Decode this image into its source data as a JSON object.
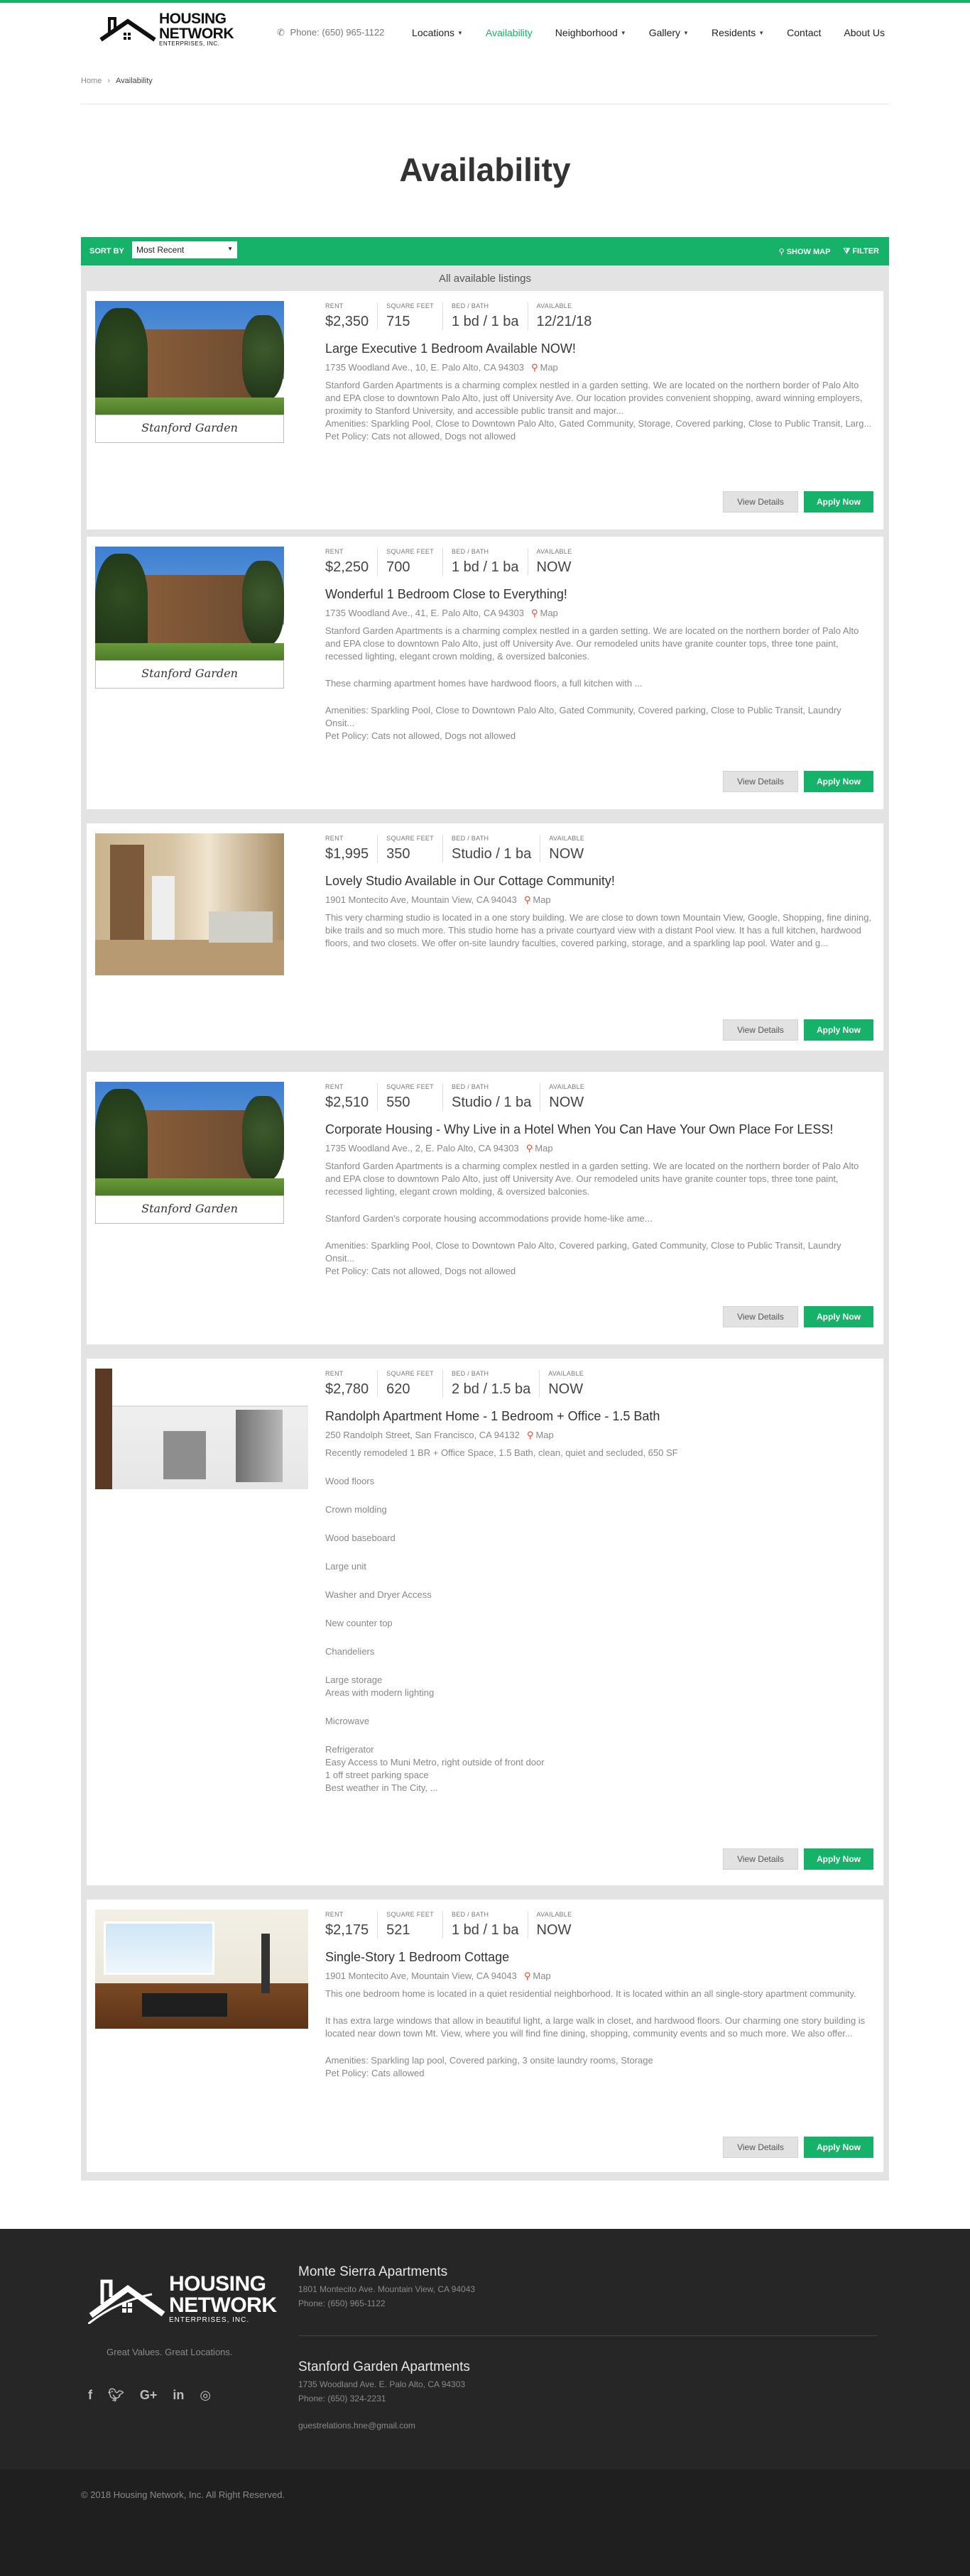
{
  "header": {
    "logo": {
      "line1": "HOUSING",
      "line2": "NETWORK",
      "line3": "ENTERPRISES, INC."
    },
    "phone": "Phone: (650) 965-1122",
    "nav": [
      {
        "label": "Locations",
        "dropdown": true,
        "active": false
      },
      {
        "label": "Availability",
        "dropdown": false,
        "active": true
      },
      {
        "label": "Neighborhood",
        "dropdown": true,
        "active": false
      },
      {
        "label": "Gallery",
        "dropdown": true,
        "active": false
      },
      {
        "label": "Residents",
        "dropdown": true,
        "active": false
      },
      {
        "label": "Contact",
        "dropdown": false,
        "active": false
      },
      {
        "label": "About Us",
        "dropdown": false,
        "active": false
      }
    ]
  },
  "breadcrumb": {
    "home": "Home",
    "separator": "›",
    "current": "Availability"
  },
  "page_title": "Availability",
  "toolbar": {
    "sort_label": "SORT BY",
    "sort_value": "Most Recent",
    "show_map": "SHOW MAP",
    "filter": "FILTER"
  },
  "listings_header": "All available listings",
  "labels": {
    "rent": "RENT",
    "sqft": "SQUARE FEET",
    "bed_bath": "BED / BATH",
    "available": "AVAILABLE",
    "map": "Map",
    "view_details": "View Details",
    "apply_now": "Apply Now"
  },
  "listings": [
    {
      "rent": "$2,350",
      "sqft": "715",
      "bed_bath": "1 bd / 1 ba",
      "available": "12/21/18",
      "title": "Large Executive 1 Bedroom Available NOW!",
      "address": "1735 Woodland Ave., 10, E. Palo Alto, CA 94303",
      "photo_caption": "Stanford Garden",
      "desc": [
        "Stanford Garden Apartments is a charming complex nestled in a garden setting. We are located on the northern border of Palo Alto and EPA close to downtown Palo Alto, just off University Ave. Our location provides convenient shopping, award winning employers, proximity to Stanford University, and accessible public transit and major...",
        "Amenities: Sparkling Pool, Close to Downtown Palo Alto, Gated Community, Storage, Covered parking, Close to Public Transit, Larg...",
        "Pet Policy: Cats not allowed, Dogs not allowed"
      ]
    },
    {
      "rent": "$2,250",
      "sqft": "700",
      "bed_bath": "1 bd / 1 ba",
      "available": "NOW",
      "title": "Wonderful 1 Bedroom Close to Everything!",
      "address": "1735 Woodland Ave., 41, E. Palo Alto, CA 94303",
      "photo_caption": "Stanford Garden",
      "desc": [
        "Stanford Garden Apartments is a charming complex nestled in a garden setting. We are located on the northern border of Palo Alto and EPA close to downtown Palo Alto, just off University Ave. Our remodeled units have granite counter tops, three tone paint, recessed lighting, elegant crown molding, & oversized balconies.",
        "These charming apartment homes have hardwood floors, a full kitchen with ...",
        "Amenities: Sparkling Pool, Close to Downtown Palo Alto, Gated Community, Covered parking, Close to Public Transit, Laundry Onsit...",
        "Pet Policy: Cats not allowed, Dogs not allowed"
      ]
    },
    {
      "rent": "$1,995",
      "sqft": "350",
      "bed_bath": "Studio / 1 ba",
      "available": "NOW",
      "title": "Lovely Studio Available in Our Cottage Community!",
      "address": "1901 Montecito Ave, Mountain View, CA 94043",
      "desc": [
        "This very charming studio is located in a one story building. We are close to down town Mountain View, Google, Shopping, fine dining, bike trails and so much more. This studio home has a private courtyard view with a distant Pool view. It has a full kitchen, hardwood floors, and two closets. We offer on-site laundry faculties, covered parking, storage, and a sparkling lap pool. Water and g..."
      ]
    },
    {
      "rent": "$2,510",
      "sqft": "550",
      "bed_bath": "Studio / 1 ba",
      "available": "NOW",
      "title": "Corporate Housing - Why Live in a Hotel When You Can Have Your Own Place For LESS!",
      "address": "1735 Woodland Ave., 2, E. Palo Alto, CA 94303",
      "photo_caption": "Stanford Garden",
      "desc": [
        "Stanford Garden Apartments is a charming complex nestled in a garden setting. We are located on the northern border of Palo Alto and EPA close to downtown Palo Alto, just off University Ave. Our remodeled units have granite counter tops, three tone paint, recessed lighting, elegant crown molding, & oversized balconies.",
        "Stanford Garden's corporate housing accommodations provide home-like ame...",
        "Amenities: Sparkling Pool, Close to Downtown Palo Alto, Covered parking, Gated Community, Close to Public Transit, Laundry Onsit...",
        "Pet Policy: Cats not allowed, Dogs not allowed"
      ]
    },
    {
      "rent": "$2,780",
      "sqft": "620",
      "bed_bath": "2 bd / 1.5 ba",
      "available": "NOW",
      "title": "Randolph Apartment Home - 1 Bedroom + Office - 1.5 Bath",
      "address": "250 Randolph Street, San Francisco, CA 94132",
      "desc_intro": "Recently remodeled 1 BR + Office Space, 1.5 Bath, clean, quiet and secluded, 650 SF",
      "features": [
        "Wood floors",
        "Crown molding",
        "Wood baseboard",
        "Large unit",
        "Washer and Dryer Access",
        "New counter top",
        "Chandeliers"
      ],
      "features_b": [
        "Large storage",
        "Areas with modern lighting"
      ],
      "features_c": [
        "Microwave"
      ],
      "features_d": [
        "Refrigerator",
        "Easy Access to Muni Metro, right outside of front door",
        "1 off street parking space",
        "Best weather in The City, ..."
      ]
    },
    {
      "rent": "$2,175",
      "sqft": "521",
      "bed_bath": "1 bd / 1 ba",
      "available": "NOW",
      "title": "Single-Story 1 Bedroom Cottage",
      "address": "1901 Montecito Ave, Mountain View, CA 94043",
      "desc": [
        "This one bedroom home is located in a quiet residential neighborhood. It is located within an all single-story apartment community.",
        "It has extra large windows that allow in beautiful light, a large walk in closet, and hardwood floors. Our charming one story building is located near down town Mt. View, where you will find fine dining, shopping, community events and so much more. We also offer...",
        "Amenities: Sparkling lap pool, Covered parking, 3 onsite laundry rooms, Storage",
        "Pet Policy: Cats allowed"
      ]
    }
  ],
  "footer": {
    "logo": {
      "line1": "HOUSING",
      "line2": "NETWORK",
      "line3": "ENTERPRISES, INC."
    },
    "tagline": "Great Values. Great Locations.",
    "socials": [
      "facebook-icon",
      "twitter-icon",
      "google-plus-icon",
      "linkedin-icon",
      "instagram-icon"
    ],
    "locations": [
      {
        "name": "Monte Sierra Apartments",
        "address": "1801 Montecito Ave. Mountain View, CA 94043",
        "phone": "Phone: (650) 965-1122"
      },
      {
        "name": "Stanford Garden Apartments",
        "address": "1735 Woodland Ave. E. Palo Alto, CA 94303",
        "phone": "Phone: (650) 324-2231"
      }
    ],
    "email": "guestrelations.hne@gmail.com",
    "copyright": "© 2018 Housing Network, Inc. All Right Reserved."
  },
  "colors": {
    "accent": "#17b26a",
    "footer": "#262626",
    "footer_bottom": "#1f1f1f",
    "pin": "#e4462a"
  }
}
